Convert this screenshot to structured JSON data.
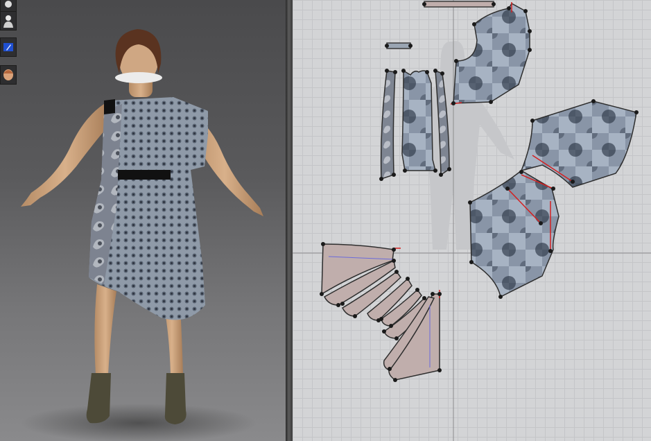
{
  "app": {
    "name": ""
  },
  "toolbar": {
    "tools": [
      {
        "name": "avatar-mannequin-icon"
      },
      {
        "name": "avatar-torso-icon"
      },
      {
        "name": "avatar-display-icon"
      },
      {
        "name": "avatar-face-icon"
      }
    ]
  },
  "colors": {
    "viewport_top": "#4a4a4c",
    "viewport_bottom": "#8a8a8c",
    "pattern_grid_bg": "#d3d4d6",
    "pattern_piece_fill": "#c0aeac",
    "pattern_outline": "#3a3a3a",
    "seam_line": "#d42020",
    "fabric_base": "#8f9aa8",
    "belt": "#111111",
    "skin": "#c9a07a",
    "hair": "#5a3320",
    "shoe": "#4d4a38"
  },
  "pattern_pieces": [
    {
      "name": "bodice-front",
      "textured": true
    },
    {
      "name": "bodice-back",
      "textured": true
    },
    {
      "name": "side-panel-left",
      "textured": true
    },
    {
      "name": "side-panel-right",
      "textured": true
    },
    {
      "name": "skirt-upper-panel",
      "textured": true
    },
    {
      "name": "skirt-lower-panel",
      "textured": true
    },
    {
      "name": "drape-fan-piece",
      "textured": false
    },
    {
      "name": "drape-lower-piece",
      "textured": false
    }
  ]
}
